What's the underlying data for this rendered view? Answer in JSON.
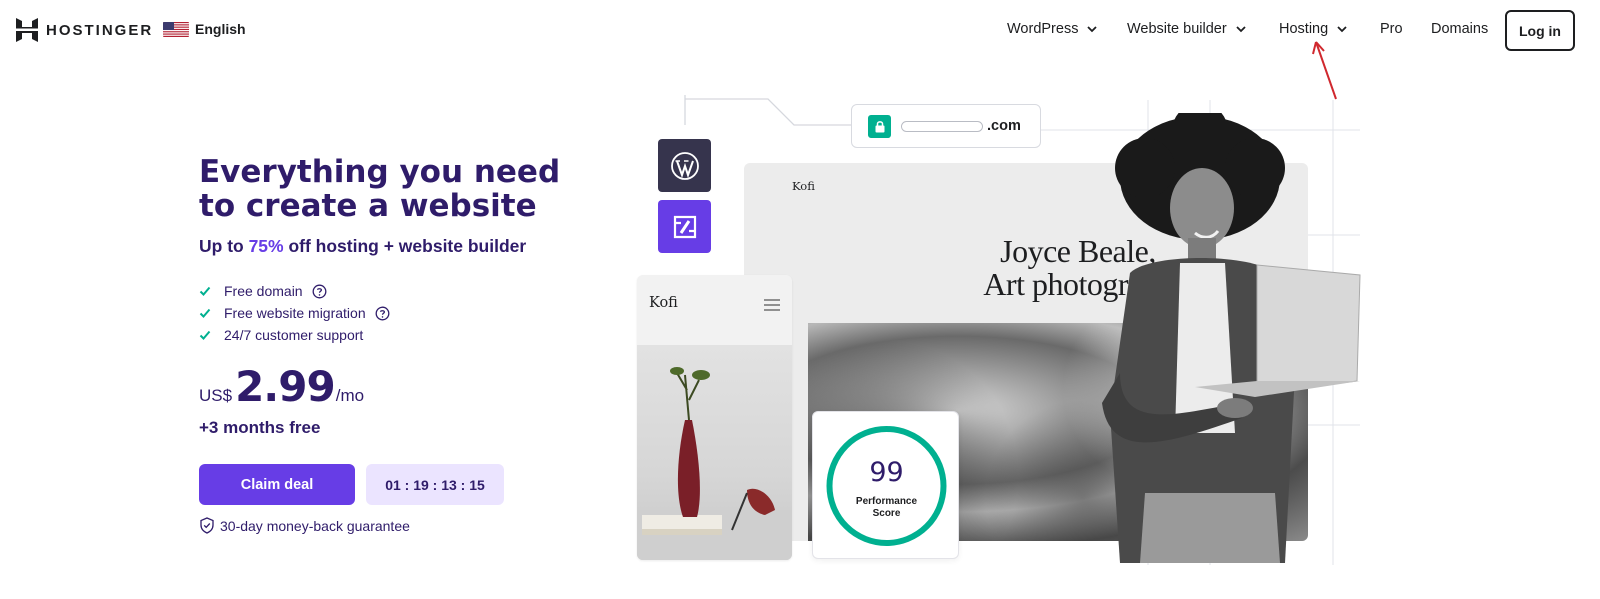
{
  "header": {
    "brand": "HOSTINGER",
    "language": "English",
    "nav": [
      {
        "label": "WordPress",
        "has_dropdown": true
      },
      {
        "label": "Website builder",
        "has_dropdown": true
      },
      {
        "label": "Hosting",
        "has_dropdown": true
      },
      {
        "label": "Pro",
        "has_dropdown": false
      },
      {
        "label": "Domains",
        "has_dropdown": false
      }
    ],
    "login_label": "Log in"
  },
  "hero": {
    "title": "Everything you need to create a website",
    "subtitle_prefix": "Up to ",
    "subtitle_accent": "75%",
    "subtitle_suffix": " off hosting + website builder",
    "features": [
      {
        "label": "Free domain",
        "has_help": true
      },
      {
        "label": "Free website migration",
        "has_help": true
      },
      {
        "label": "24/7 customer support",
        "has_help": false
      }
    ],
    "price": {
      "currency": "US$",
      "value": "2.99",
      "period": "/mo"
    },
    "bonus": "+3 months free",
    "cta_label": "Claim deal",
    "countdown": "01 : 19 : 13 : 15",
    "guarantee": "30-day money-back guarantee"
  },
  "illustration": {
    "url_tld": ".com",
    "site_brand": "Kofi",
    "site_headline_line1": "Joyce Beale,",
    "site_headline_line2": "Art photograph",
    "mobile_brand": "Kofi",
    "performance_score": "99",
    "performance_label_line1": "Performance",
    "performance_label_line2": "Score"
  },
  "colors": {
    "primary": "#673de6",
    "primary_dark": "#2f1c6a",
    "accent_green": "#00b090",
    "timer_bg": "#ebe4ff",
    "annotation_red": "#d0282e"
  },
  "icons": [
    "hostinger-logo",
    "us-flag-icon",
    "chevron-down-icon",
    "check-icon",
    "help-circle-icon",
    "shield-check-icon",
    "lock-icon",
    "wordpress-icon",
    "website-builder-icon",
    "hamburger-menu-icon"
  ]
}
